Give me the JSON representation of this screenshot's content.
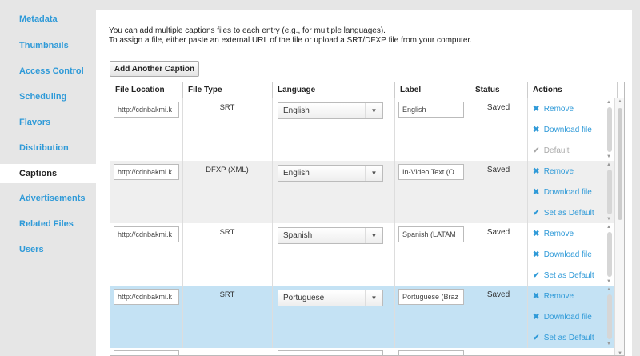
{
  "sidebar": {
    "items": [
      {
        "label": "Metadata",
        "active": false
      },
      {
        "label": "Thumbnails",
        "active": false
      },
      {
        "label": "Access Control",
        "active": false
      },
      {
        "label": "Scheduling",
        "active": false
      },
      {
        "label": "Flavors",
        "active": false
      },
      {
        "label": "Distribution",
        "active": false
      },
      {
        "label": "Captions",
        "active": true
      },
      {
        "label": "Advertisements",
        "active": false
      },
      {
        "label": "Related Files",
        "active": false
      },
      {
        "label": "Users",
        "active": false
      }
    ]
  },
  "main": {
    "intro_line1": "You can add multiple captions files to each entry (e.g., for multiple languages).",
    "intro_line2": "To assign a file, either paste an external URL of the file or upload a SRT/DFXP file from your computer.",
    "add_button": "Add Another Caption"
  },
  "table": {
    "headers": [
      "File Location",
      "File Type",
      "Language",
      "Label",
      "Status",
      "Actions"
    ],
    "rows": [
      {
        "location": "http://cdnbakmi.k",
        "type": "SRT",
        "language": "English",
        "label": "English",
        "status": "Saved",
        "actions": [
          "Remove",
          "Download file",
          "Default"
        ],
        "default_disabled": true,
        "selected": false
      },
      {
        "location": "http://cdnbakmi.k",
        "type": "DFXP (XML)",
        "language": "English",
        "label": "In-Video Text (O",
        "status": "Saved",
        "actions": [
          "Remove",
          "Download file",
          "Set as Default"
        ],
        "default_disabled": false,
        "selected": false
      },
      {
        "location": "http://cdnbakmi.k",
        "type": "SRT",
        "language": "Spanish",
        "label": "Spanish (LATAM",
        "status": "Saved",
        "actions": [
          "Remove",
          "Download file",
          "Set as Default"
        ],
        "default_disabled": false,
        "selected": false
      },
      {
        "location": "http://cdnbakmi.k",
        "type": "SRT",
        "language": "Portuguese",
        "label": "Portuguese (Braz",
        "status": "Saved",
        "actions": [
          "Remove",
          "Download file",
          "Set as Default"
        ],
        "default_disabled": false,
        "selected": true
      }
    ]
  },
  "colors": {
    "link": "#2f9ad8",
    "selected_row": "#c4e2f4",
    "alt_row": "#efefef"
  },
  "icons": {
    "remove": "x-icon",
    "download": "download-icon",
    "default": "checkmark-icon",
    "dropdown": "chevron-down-icon"
  }
}
